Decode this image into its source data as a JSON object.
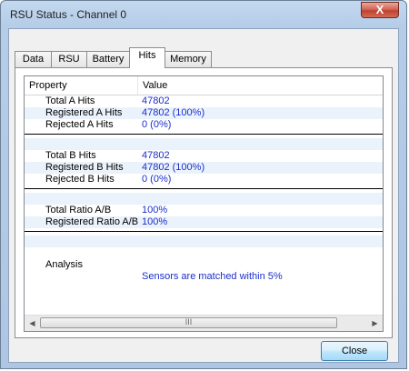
{
  "window": {
    "title": "RSU Status - Channel 0",
    "close_glyph": "X"
  },
  "tabs": [
    {
      "label": "Data"
    },
    {
      "label": "RSU"
    },
    {
      "label": "Battery"
    },
    {
      "label": "Hits",
      "active": true
    },
    {
      "label": "Memory"
    }
  ],
  "listview": {
    "columns": [
      "Property",
      "Value"
    ],
    "rows": [
      {
        "property": "Total A Hits",
        "value": "47802"
      },
      {
        "property": "Registered A Hits",
        "value": "47802 (100%)"
      },
      {
        "property": "Rejected A Hits",
        "value": "0 (0%)"
      },
      {
        "property": "",
        "value": ""
      },
      {
        "property": "Total B Hits",
        "value": "47802"
      },
      {
        "property": "Registered B Hits",
        "value": "47802 (100%)"
      },
      {
        "property": "Rejected B Hits",
        "value": "0 (0%)"
      },
      {
        "property": "",
        "value": ""
      },
      {
        "property": "Total Ratio A/B",
        "value": "100%"
      },
      {
        "property": "Registered Ratio A/B",
        "value": "100%"
      },
      {
        "property": "",
        "value": ""
      },
      {
        "property": "Analysis",
        "value": ""
      },
      {
        "property": "",
        "value": "Sensors are matched within 5%"
      }
    ]
  },
  "scrollbar": {
    "left_arrow": "◀",
    "right_arrow": "▶",
    "thumb_grip": "III"
  },
  "buttons": {
    "close_label": "Close"
  }
}
